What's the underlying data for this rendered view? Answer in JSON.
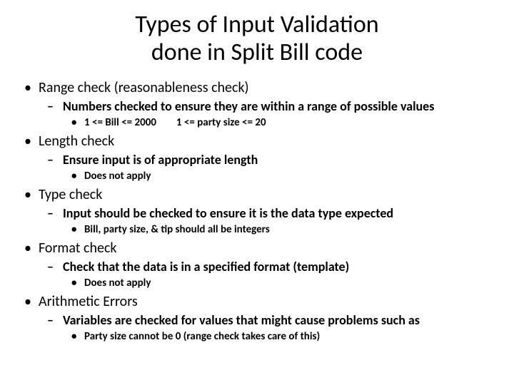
{
  "title_line1": "Types of Input Validation",
  "title_line2": "done in Split Bill code",
  "items": [
    {
      "label": "Range check (reasonableness check)",
      "sub": "Numbers checked to ensure they are within a range of possible values",
      "detail_a": "1 <= Bill <= 2000",
      "detail_b": "1 <= party size <= 20"
    },
    {
      "label": "Length check",
      "sub": "Ensure input is of appropriate length",
      "detail": "Does not apply"
    },
    {
      "label": "Type check",
      "sub": "Input should be checked to ensure it is the data type expected",
      "detail": "Bill, party size, & tip should all be integers"
    },
    {
      "label": "Format check",
      "sub": "Check that the data is in a specified format (template)",
      "detail": "Does not apply"
    },
    {
      "label": "Arithmetic Errors",
      "sub": "Variables are checked for values that might cause problems such as",
      "detail": "Party size cannot be 0 (range check takes care of this)"
    }
  ]
}
